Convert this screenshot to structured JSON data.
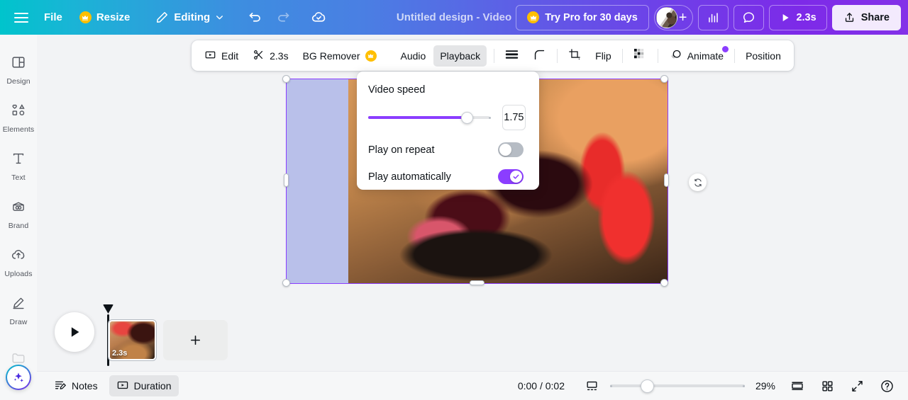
{
  "topbar": {
    "menu_icon": "hamburger-icon",
    "file_label": "File",
    "resize_label": "Resize",
    "resize_badge": "crown-icon",
    "editing_label": "Editing",
    "editing_icon": "pencil-icon",
    "editing_chevron": "chevron-down-icon",
    "undo_icon": "undo-icon",
    "redo_icon": "redo-icon",
    "cloud_icon": "cloud-saved-icon",
    "title": "Untitled design - Video",
    "try_pro_label": "Try Pro for 30 days",
    "try_pro_icon": "crown-icon",
    "avatar": "user-avatar",
    "add_member_icon": "plus-icon",
    "insights_icon": "bar-chart-icon",
    "comments_icon": "comment-bubble-icon",
    "present_icon": "play-icon",
    "present_label": "2.3s",
    "share_icon": "share-upload-icon",
    "share_label": "Share"
  },
  "sidebar": {
    "items": [
      {
        "label": "Design",
        "icon": "layout-icon"
      },
      {
        "label": "Elements",
        "icon": "shapes-icon"
      },
      {
        "label": "Text",
        "icon": "text-icon"
      },
      {
        "label": "Brand",
        "icon": "brand-icon"
      },
      {
        "label": "Uploads",
        "icon": "cloud-upload-icon"
      },
      {
        "label": "Draw",
        "icon": "pen-icon"
      }
    ],
    "magic_button": "magic-sparkle-icon"
  },
  "toolbar": {
    "edit_icon": "video-edit-icon",
    "edit_label": "Edit",
    "scissors_icon": "scissors-icon",
    "duration_label": "2.3s",
    "bg_remover_label": "BG Remover",
    "bg_remover_badge": "crown-icon",
    "audio_label": "Audio",
    "playback_label": "Playback",
    "playback_active": true,
    "transparency_icon": "transparency-icon",
    "corner_icon": "corner-radius-icon",
    "crop_icon": "crop-icon",
    "flip_label": "Flip",
    "effects_icon": "checker-effects-icon",
    "animate_icon": "animate-icon",
    "animate_label": "Animate",
    "animate_badge_color": "#8b3dff",
    "position_label": "Position"
  },
  "popup": {
    "speed_label": "Video speed",
    "speed_value": "1.75",
    "speed_min": 0.25,
    "speed_max": 2.0,
    "speed_current": 1.75,
    "repeat_label": "Play on repeat",
    "repeat_on": false,
    "autoplay_label": "Play automatically",
    "autoplay_on": true,
    "accent_color": "#8b3dff",
    "check_icon": "check-icon"
  },
  "canvas": {
    "rotate_icon": "rotate-icon",
    "selection_color": "#8b3dff"
  },
  "timeline": {
    "play_icon": "play-icon",
    "clip_duration": "2.3s",
    "add_page_icon": "plus-icon"
  },
  "bottombar": {
    "notes_icon": "notes-icon",
    "notes_label": "Notes",
    "duration_icon": "duration-icon",
    "duration_label": "Duration",
    "duration_active": true,
    "time_display": "0:00 / 0:02",
    "timeline_toggle_icon": "timeline-view-icon",
    "zoom_value": 29,
    "zoom_label": "29%",
    "page_view_icon": "single-page-icon",
    "grid_view_icon": "grid-view-icon",
    "fullscreen_icon": "fullscreen-icon",
    "help_icon": "help-icon"
  }
}
